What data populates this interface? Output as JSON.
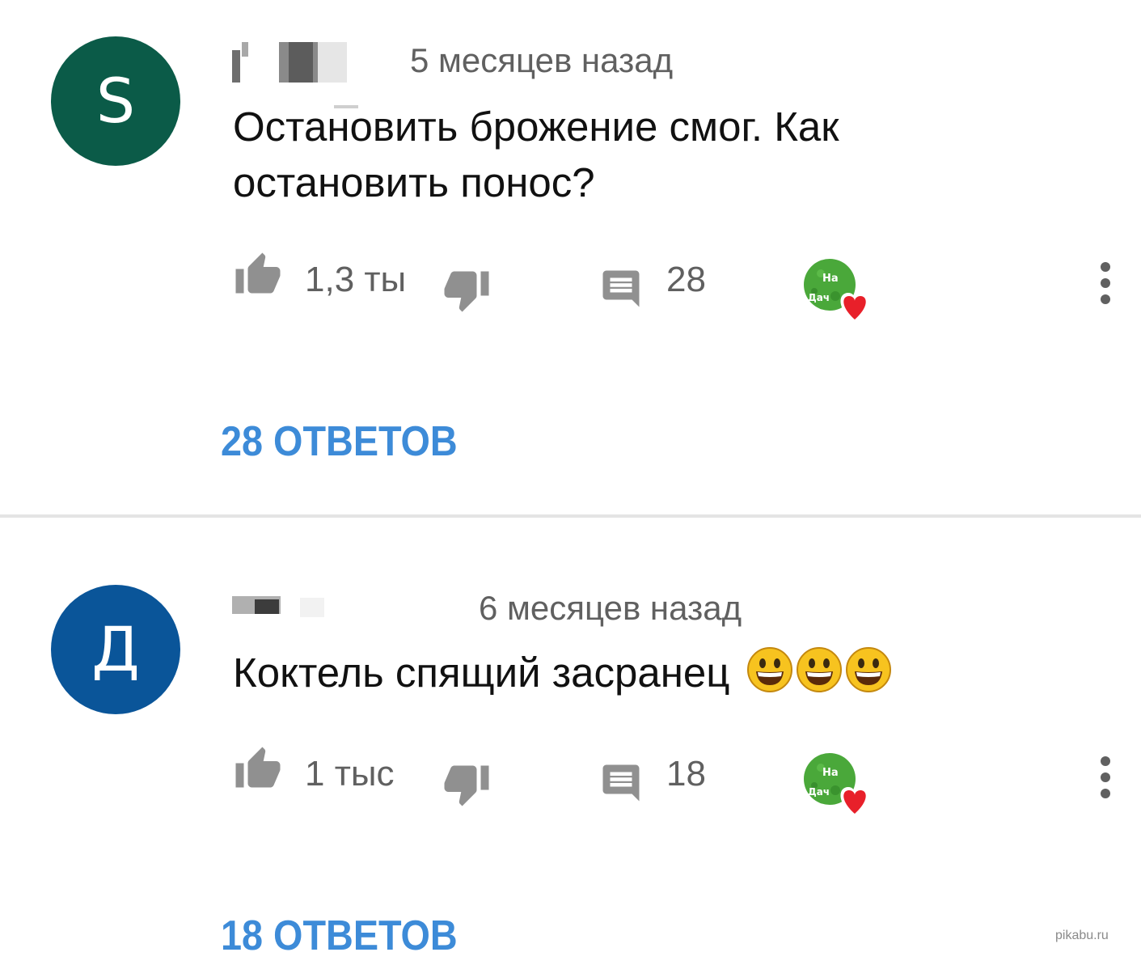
{
  "comments": [
    {
      "avatar_letter": "S",
      "avatar_color": "#0b5b48",
      "timestamp": "5 месяцев назад",
      "text": "Остановить брожение смог. Как остановить понос?",
      "emojis": [],
      "like_count": "1,3 ты",
      "reply_count": "28",
      "replies_link": "28 ОТВЕТОВ",
      "creator_badge_text": "На Дач"
    },
    {
      "avatar_letter": "Д",
      "avatar_color": "#0a5599",
      "timestamp": "6 месяцев назад",
      "text": "Коктель спящий засранец",
      "emojis": [
        "grinning-face-emoji",
        "grinning-face-emoji",
        "grinning-face-emoji"
      ],
      "like_count": "1 тыс",
      "reply_count": "18",
      "replies_link": "18 ОТВЕТОВ",
      "creator_badge_text": "На Дач"
    }
  ],
  "colors": {
    "link_blue": "#3d8bd8",
    "secondary_text": "#606060",
    "icon_gray": "#909090",
    "heart_red": "#e8202a",
    "divider": "#e4e4e4"
  },
  "icons": {
    "like": "thumbs-up-icon",
    "dislike": "thumbs-down-icon",
    "reply": "comment-bubble-icon",
    "creator": "creator-heart-badge",
    "menu": "vertical-dots-icon"
  },
  "watermark": "pikabu.ru"
}
